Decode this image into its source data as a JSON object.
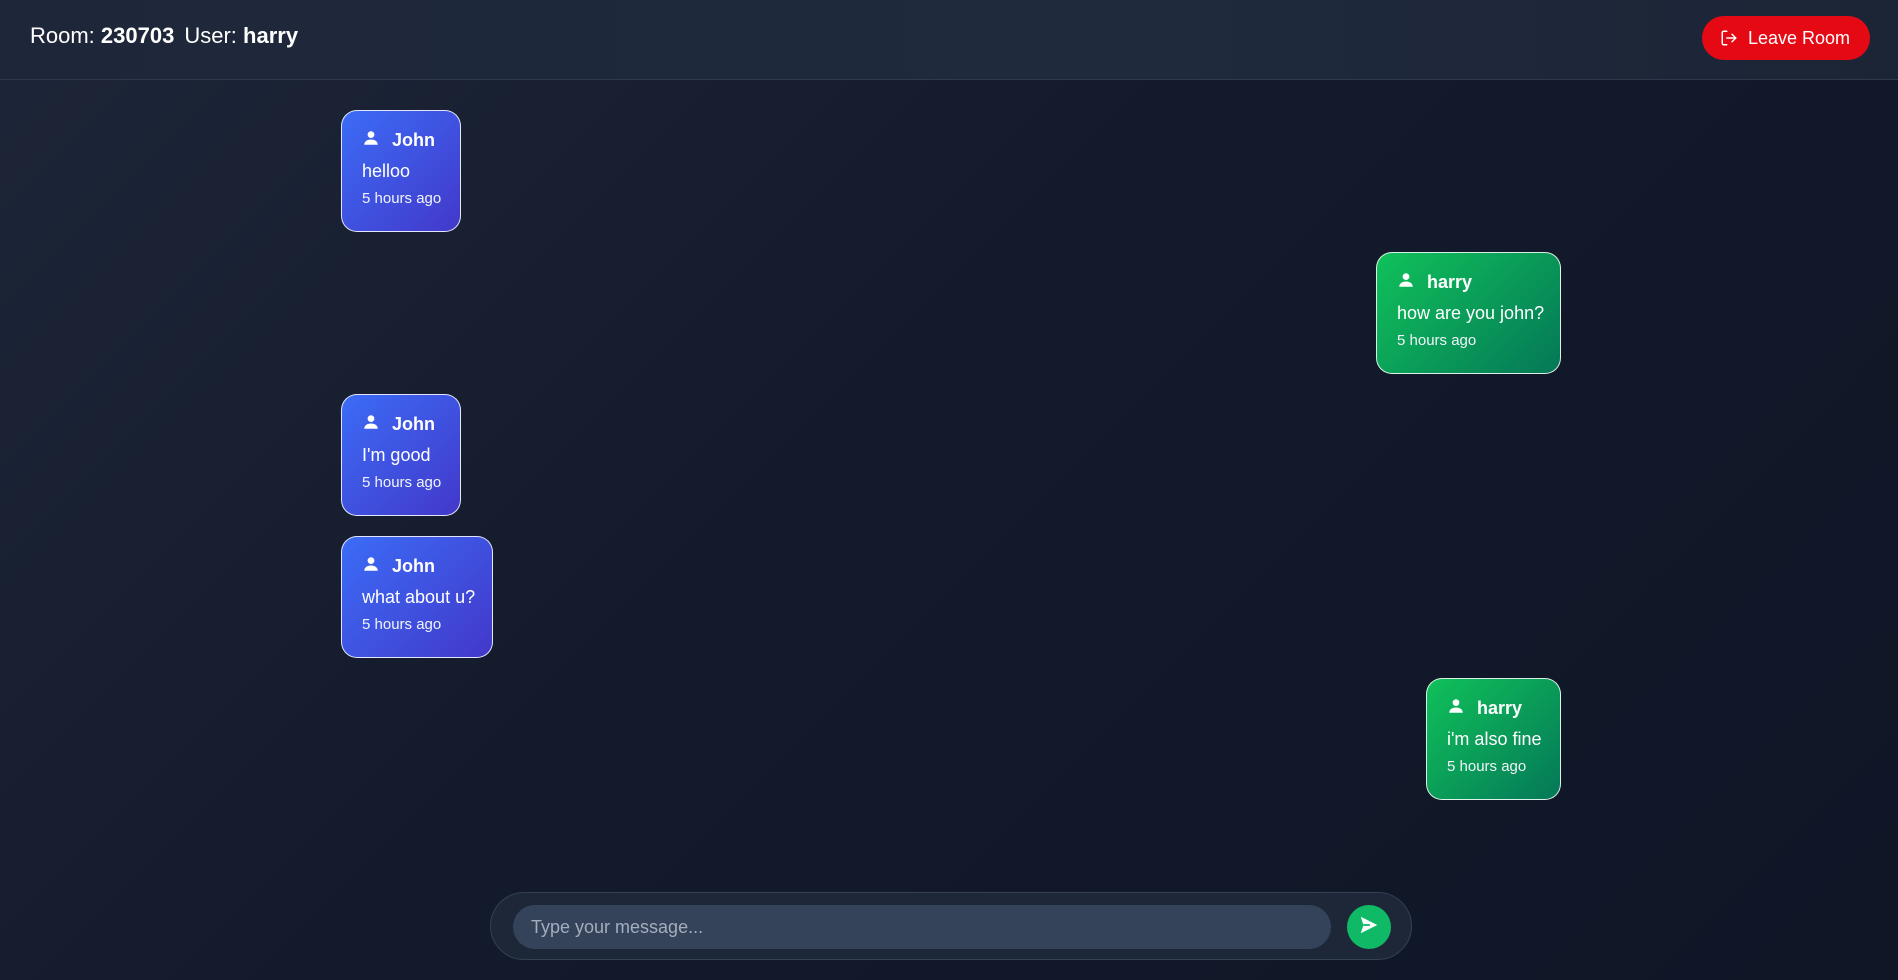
{
  "header": {
    "room_label": "Room:",
    "room_id": "230703",
    "user_label": "User:",
    "user_name": "harry",
    "leave_label": "Leave Room"
  },
  "messages": [
    {
      "author": "John",
      "text": "helloo",
      "time": "5 hours ago",
      "side": "other"
    },
    {
      "author": "harry",
      "text": "how are you john?",
      "time": "5 hours ago",
      "side": "self"
    },
    {
      "author": "John",
      "text": "I'm good",
      "time": "5 hours ago",
      "side": "other"
    },
    {
      "author": "John",
      "text": "what about u?",
      "time": "5 hours ago",
      "side": "other"
    },
    {
      "author": "harry",
      "text": "i'm also fine",
      "time": "5 hours ago",
      "side": "self"
    }
  ],
  "composer": {
    "placeholder": "Type your message...",
    "value": ""
  },
  "icons": {
    "leave": "logout-icon",
    "user": "user-icon",
    "send": "send-icon"
  },
  "colors": {
    "leave_button": "#e50914",
    "other_bubble": "#3b6cf6",
    "self_bubble": "#10c15a",
    "send_button": "#10b966"
  }
}
